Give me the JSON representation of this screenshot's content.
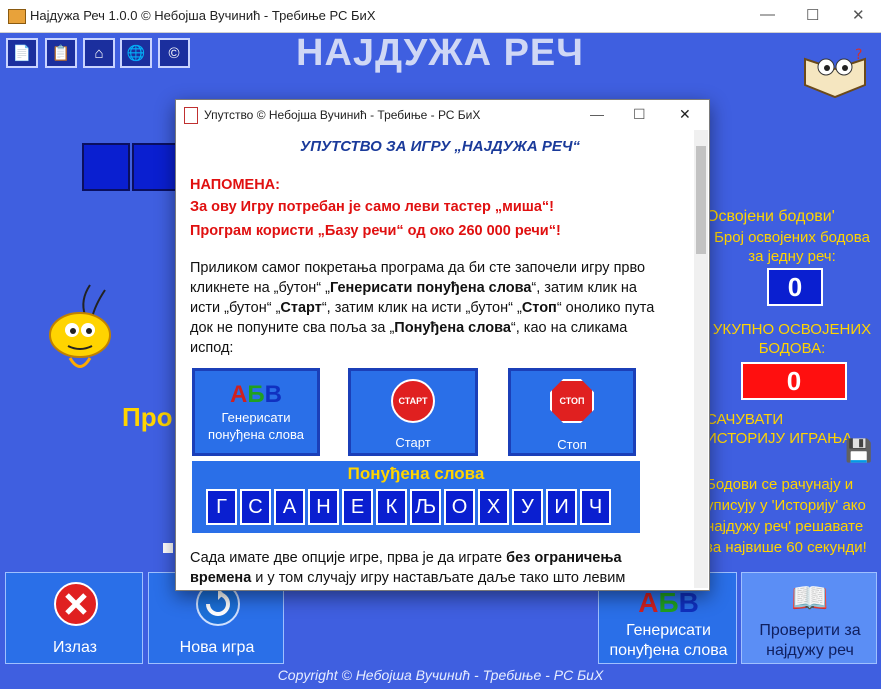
{
  "window": {
    "title": "Најдужа Реч 1.0.0   ©   Небојша Вучинић - Требиње РС БиХ",
    "ctl_min": "—",
    "ctl_max": "☐",
    "ctl_close": "✕"
  },
  "toolbar": {
    "icons": [
      "pdf-icon",
      "document-icon",
      "home-icon",
      "globe-icon",
      "copyright-icon"
    ],
    "glyphs": [
      "📄",
      "📋",
      "⌂",
      "🌐",
      "©"
    ]
  },
  "main": {
    "title": "НАЈДУЖА РЕЧ",
    "partial_label": "Про"
  },
  "right_panel": {
    "points_title": "Освојени бодови'",
    "points_per_word_label": "Број освојених бодова за једну реч:",
    "points_per_word": "0",
    "total_label": "УКУПНО ОСВОЈЕНИХ БОДОВА:",
    "total": "0",
    "save_history": "САЧУВАТИ ИСТОРИЈУ ИГРАЊА",
    "note": "Бодови се рачунају и уписују у 'Историју' ако најдужу реч' решавате за највише 60 секунди!"
  },
  "bottom": {
    "exit": "Излаз",
    "new_game": "Нова игра",
    "generate": "Генерисати понуђена слова",
    "check": "Проверити за најдужу реч",
    "copyright": "Copyright © Небојша Вучинић - Требиње - РС БиХ"
  },
  "dialog": {
    "title": "Упутство © Небојша Вучинић - Требиње - РС БиХ",
    "heading": "УПУТСТВО ЗА ИГРУ „НАЈДУЖА РЕЧ“",
    "note_label": "НАПОМЕНА:",
    "note_line1": "За ову Игру потребан је само леви тастер „миша“!",
    "note_line2": "Програм користи „Базу речи“ од око 260 000 речи“!",
    "para1_a": "Приликом самог покретања програма да би сте започели игру прво кликнете на „бутон“ „",
    "para1_b": "Генерисати понуђена слова",
    "para1_c": "“, затим клик на исти „бутон“ „",
    "para1_d": "Старт",
    "para1_e": "“, затим клик на исти „бутон“ „",
    "para1_f": "Стоп",
    "para1_g": "“ онолико пута док не попуните сва поља за „",
    "para1_h": "Понуђена слова",
    "para1_i": "“, као на сликама испод:",
    "img_generate": "Генерисати понуђена слова",
    "img_start": "Старт",
    "img_start_sign": "СТАРТ",
    "img_stop": "Стоп",
    "img_stop_sign": "СТОП",
    "offered_title": "Понуђена слова",
    "letters": [
      "Г",
      "С",
      "А",
      "Н",
      "Е",
      "К",
      "Љ",
      "О",
      "Х",
      "У",
      "И",
      "Ч"
    ],
    "para2_a": "Сада имате две опције игре, прва је да играте ",
    "para2_b": "без ограничења времена",
    "para2_c": " и у том случају игру настављате даље тако што левим"
  },
  "colors": {
    "background": "#3f5fe0",
    "slot": "#0a1fd0",
    "accent_yellow": "#ffd400",
    "alert_red": "#e01010"
  }
}
